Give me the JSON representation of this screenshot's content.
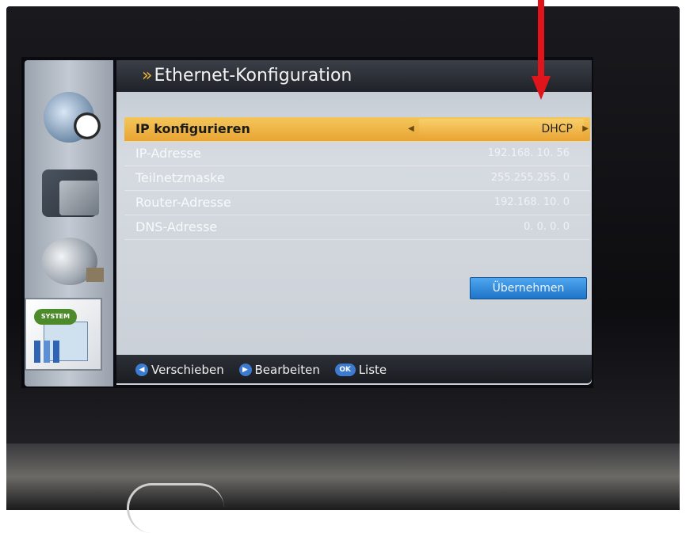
{
  "window": {
    "title": "Ethernet-Konfiguration",
    "title_prefix": "»"
  },
  "settings": [
    {
      "label": "IP konfigurieren",
      "value": "DHCP",
      "selected": true
    },
    {
      "label": "IP-Adresse",
      "value": "192.168. 10. 56"
    },
    {
      "label": "Teilnetzmaske",
      "value": "255.255.255. 0"
    },
    {
      "label": "Router-Adresse",
      "value": "192.168. 10. 0"
    },
    {
      "label": "DNS-Adresse",
      "value": "0. 0. 0. 0"
    }
  ],
  "apply_button": {
    "label": "Übernehmen"
  },
  "sidebar": {
    "system_badge": "SYSTEM"
  },
  "footer": {
    "move_label": "Verschieben",
    "edit_label": "Bearbeiten",
    "ok_key": "OK",
    "list_label": "Liste"
  },
  "colors": {
    "highlight": "#f4c65a",
    "accent_button": "#1f74c6",
    "annotation_arrow": "#e0151b"
  },
  "icons": [
    "globe-clock-icon",
    "folder-icon",
    "satellite-dish-icon",
    "system-settings-icon",
    "left-key-icon",
    "right-key-icon",
    "ok-key-icon",
    "chevron-left-icon",
    "chevron-right-icon"
  ]
}
